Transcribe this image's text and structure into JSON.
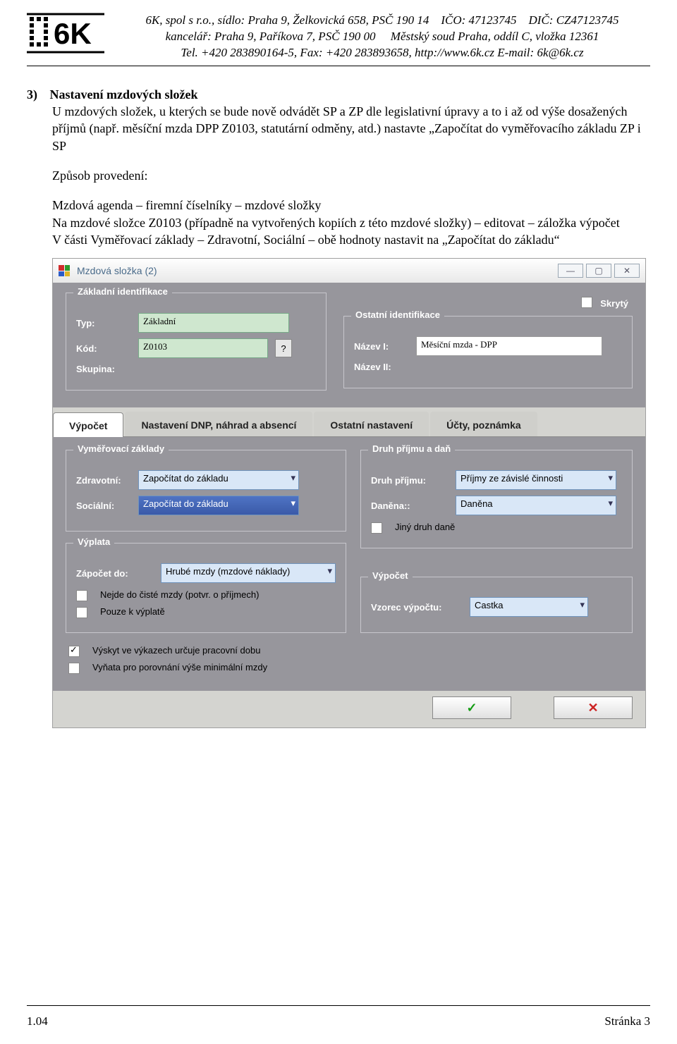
{
  "header": {
    "line1_left": "6K, spol s r.o., sídlo: Praha 9, Želkovická 658, PSČ 190 14",
    "line1_right_ico": "IČO: 47123745",
    "line1_right_dic": "DIČ:  CZ47123745",
    "line2_left": "kancelář: Praha 9, Paříkova 7, PSČ 190 00",
    "line2_right": "Městský soud Praha, oddíl C, vložka 12361",
    "line3": "Tel. +420 283890164-5,  Fax: +420 283893658,  http://www.6k.cz    E-mail:  6k@6k.cz"
  },
  "section": {
    "number": "3)",
    "title": "Nastavení mzdových složek",
    "para1": "U mzdových složek, u kterých se bude nově odvádět SP a ZP dle legislativní úpravy a to i až od výše dosažených příjmů (např. měsíční mzda DPP Z0103, statutární odměny, atd.) nastavte „Započítat do vyměřovacího základu ZP i SP",
    "method_lbl": "Způsob provedení:",
    "method1": "Mzdová agenda – firemní číselníky – mzdové složky",
    "method2": "Na mzdové složce Z0103 (případně na vytvořených kopiích z této mzdové složky) – editovat – záložka výpočet",
    "method3": "V části Vyměřovací základy – Zdravotní, Sociální – obě hodnoty nastavit na „Započítat do základu“"
  },
  "app": {
    "title": "Mzdová složka (2)",
    "winbtns": {
      "min": "—",
      "max": "▢",
      "close": "✕"
    },
    "group_ident": "Základní identifikace",
    "skryty_lbl": "Skrytý",
    "typ_lbl": "Typ:",
    "typ_val": "Základní",
    "kod_lbl": "Kód:",
    "kod_val": "Z0103",
    "kod_q": "?",
    "skup_lbl": "Skupina:",
    "group_other": "Ostatní identifikace",
    "nazev1_lbl": "Název I:",
    "nazev1_val": "Měsíční mzda - DPP",
    "nazev2_lbl": "Název II:",
    "tabs": {
      "vypocet": "Výpočet",
      "dnp": "Nastavení DNP, náhrad a absencí",
      "ostatni": "Ostatní nastavení",
      "ucty": "Účty, poznámka"
    },
    "group_vz": "Vyměřovací základy",
    "zdrav_lbl": "Zdravotní:",
    "zdrav_val": "Započítat do základu",
    "soc_lbl": "Sociální:",
    "soc_val": "Započítat do základu",
    "group_druh": "Druh příjmu a daň",
    "druh_lbl": "Druh příjmu:",
    "druh_val": "Příjmy ze závislé činnosti",
    "danena_lbl": "Daněna::",
    "danena_val": "Daněna",
    "jiny_lbl": "Jiný druh daně",
    "group_vyplata": "Výplata",
    "zapocet_lbl": "Zápočet do:",
    "zapocet_val": "Hrubé mzdy (mzdové náklady)",
    "nejde_lbl": "Nejde do čisté mzdy (potvr. o příjmech)",
    "pouze_lbl": "Pouze k výplatě",
    "group_vypocet2": "Výpočet",
    "vzorec_lbl": "Vzorec výpočtu:",
    "vzorec_val": "Castka",
    "vyskyt_lbl": "Výskyt ve výkazech určuje pracovní dobu",
    "vynata_lbl": "Vyňata pro porovnání výše minimální mzdy",
    "ok": "✓",
    "cancel": "✕"
  },
  "footer": {
    "left": "1.04",
    "right": "Stránka 3"
  }
}
